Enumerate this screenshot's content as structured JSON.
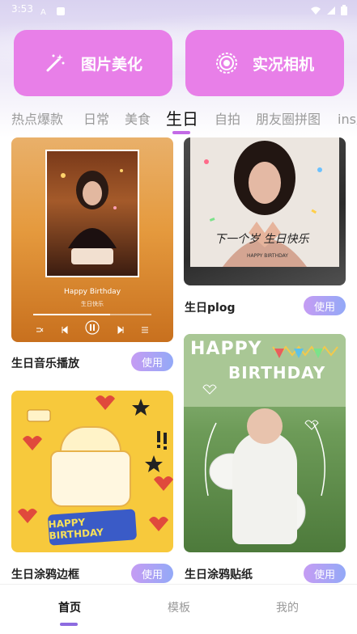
{
  "status_bar": {
    "time": "3:53"
  },
  "actions": [
    {
      "label": "图片美化",
      "icon": "magic-wand-icon"
    },
    {
      "label": "实况相机",
      "icon": "live-camera-icon"
    }
  ],
  "tabs": [
    "热点爆款",
    "日常",
    "美食",
    "生日",
    "自拍",
    "朋友圈拼图",
    "ins风"
  ],
  "active_tab": "生日",
  "cards": {
    "music": {
      "title": "生日音乐播放",
      "use": "使用",
      "song": "Happy Birthday",
      "song_sub": "生日快乐",
      "progress": 0.65
    },
    "plog": {
      "title": "生日plog",
      "use": "使用",
      "overlay": "下一个岁 生日快乐",
      "overlay_small": "HAPPY BIRTHDAY"
    },
    "doodle": {
      "title": "生日涂鸦边框",
      "use": "使用",
      "banner": "HAPPY BIRTHDAY"
    },
    "sticker": {
      "title": "生日涂鸦贴纸",
      "use": "使用",
      "headline1": "HAPPY",
      "headline2": "BIRTHDAY"
    }
  },
  "bottom_nav": [
    {
      "label": "首页",
      "active": true
    },
    {
      "label": "模板",
      "active": false
    },
    {
      "label": "我的",
      "active": false
    }
  ],
  "colors": {
    "action_bg": "#e87fe8",
    "accent": "#c36ae6",
    "use_grad_start": "#c59cf3",
    "use_grad_end": "#93a9f7"
  }
}
